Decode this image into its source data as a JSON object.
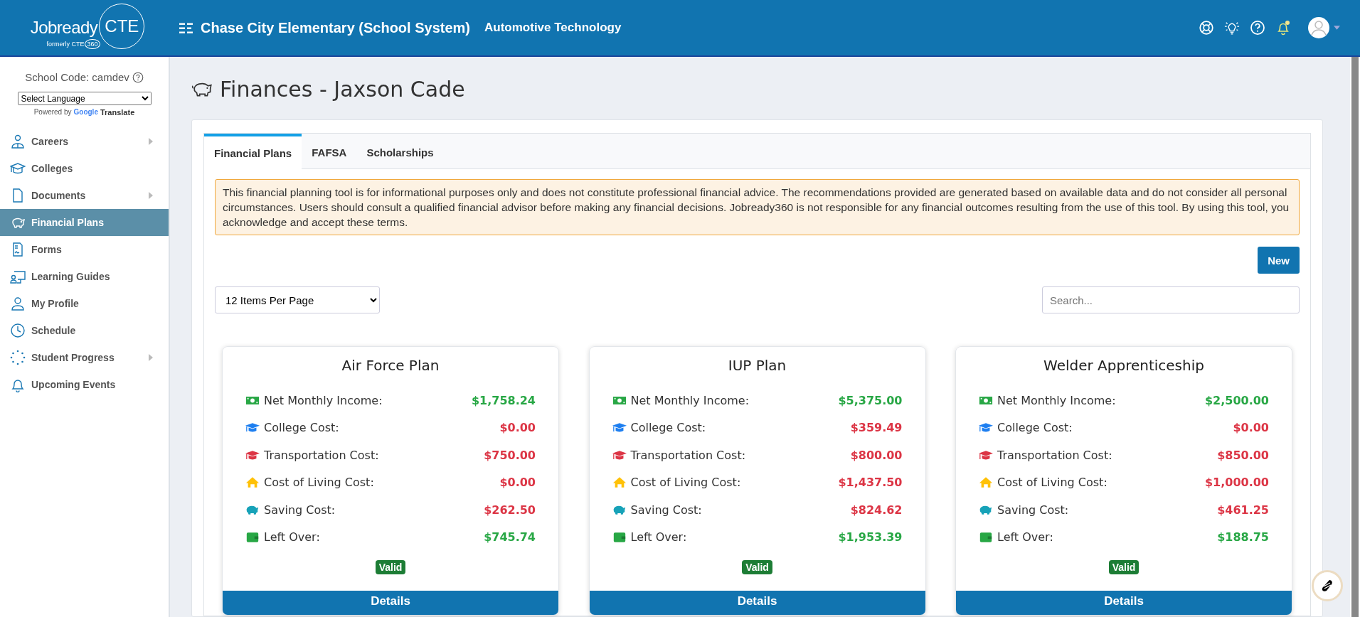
{
  "header": {
    "logo_text": "Jobready",
    "logo_badge": "CTE",
    "logo_sub": "formerly CTE",
    "logo_sub_badge": "360",
    "school": "Chase City Elementary (School System)",
    "program": "Automotive Technology",
    "notification_dot": true
  },
  "sidebar": {
    "school_code": "School Code: camdev",
    "language_select": "Select Language",
    "powered_by": "Powered by",
    "google": "Google",
    "translate": "Translate",
    "items": [
      {
        "kind": "careers",
        "label": "Careers",
        "has_submenu": true,
        "selected": false
      },
      {
        "kind": "colleges",
        "label": "Colleges",
        "has_submenu": false,
        "selected": false
      },
      {
        "kind": "documents",
        "label": "Documents",
        "has_submenu": true,
        "selected": false
      },
      {
        "kind": "finance",
        "label": "Financial Plans",
        "has_submenu": false,
        "selected": true
      },
      {
        "kind": "forms",
        "label": "Forms",
        "has_submenu": false,
        "selected": false
      },
      {
        "kind": "guides",
        "label": "Learning Guides",
        "has_submenu": false,
        "selected": false
      },
      {
        "kind": "profile",
        "label": "My Profile",
        "has_submenu": false,
        "selected": false
      },
      {
        "kind": "schedule",
        "label": "Schedule",
        "has_submenu": false,
        "selected": false
      },
      {
        "kind": "progress",
        "label": "Student Progress",
        "has_submenu": true,
        "selected": false
      },
      {
        "kind": "events",
        "label": "Upcoming Events",
        "has_submenu": false,
        "selected": false
      }
    ]
  },
  "page": {
    "title": "Finances - Jaxson Cade"
  },
  "tabs": [
    {
      "label": "Financial Plans",
      "selected": true
    },
    {
      "label": "FAFSA",
      "selected": false
    },
    {
      "label": "Scholarships",
      "selected": false
    }
  ],
  "disclaimer": "This financial planning tool is for informational purposes only and does not constitute professional financial advice. The recommendations provided are generated based on available data and do not consider all personal circumstances. Users should consult a qualified financial advisor before making any financial decisions. Jobready360 is not responsible for any financial outcomes resulting from the use of this tool. By using this tool, you acknowledge and accept these terms.",
  "new_button": "New",
  "page_size": "12 Items Per Page",
  "search": {
    "placeholder": "Search..."
  },
  "plans": [
    {
      "title": "Air Force Plan",
      "status": "Valid",
      "action": "Details",
      "rows": [
        {
          "kind": "income",
          "label": "Net Monthly Income:",
          "value": "$1,758.24",
          "color": "#28a745"
        },
        {
          "kind": "college",
          "label": "College Cost:",
          "value": "$0.00",
          "color": "#dc3545"
        },
        {
          "kind": "transport",
          "label": "Transportation Cost:",
          "value": "$750.00",
          "color": "#dc3545"
        },
        {
          "kind": "living",
          "label": "Cost of Living Cost:",
          "value": "$0.00",
          "color": "#dc3545"
        },
        {
          "kind": "saving",
          "label": "Saving Cost:",
          "value": "$262.50",
          "color": "#dc3545"
        },
        {
          "kind": "leftover",
          "label": "Left Over:",
          "value": "$745.74",
          "color": "#28a745"
        }
      ]
    },
    {
      "title": "IUP Plan",
      "status": "Valid",
      "action": "Details",
      "rows": [
        {
          "kind": "income",
          "label": "Net Monthly Income:",
          "value": "$5,375.00",
          "color": "#28a745"
        },
        {
          "kind": "college",
          "label": "College Cost:",
          "value": "$359.49",
          "color": "#dc3545"
        },
        {
          "kind": "transport",
          "label": "Transportation Cost:",
          "value": "$800.00",
          "color": "#dc3545"
        },
        {
          "kind": "living",
          "label": "Cost of Living Cost:",
          "value": "$1,437.50",
          "color": "#dc3545"
        },
        {
          "kind": "saving",
          "label": "Saving Cost:",
          "value": "$824.62",
          "color": "#dc3545"
        },
        {
          "kind": "leftover",
          "label": "Left Over:",
          "value": "$1,953.39",
          "color": "#28a745"
        }
      ]
    },
    {
      "title": "Welder Apprenticeship",
      "status": "Valid",
      "action": "Details",
      "rows": [
        {
          "kind": "income",
          "label": "Net Monthly Income:",
          "value": "$2,500.00",
          "color": "#28a745"
        },
        {
          "kind": "college",
          "label": "College Cost:",
          "value": "$0.00",
          "color": "#dc3545"
        },
        {
          "kind": "transport",
          "label": "Transportation Cost:",
          "value": "$850.00",
          "color": "#dc3545"
        },
        {
          "kind": "living",
          "label": "Cost of Living Cost:",
          "value": "$1,000.00",
          "color": "#dc3545"
        },
        {
          "kind": "saving",
          "label": "Saving Cost:",
          "value": "$461.25",
          "color": "#dc3545"
        },
        {
          "kind": "leftover",
          "label": "Left Over:",
          "value": "$188.75",
          "color": "#28a745"
        }
      ]
    }
  ]
}
